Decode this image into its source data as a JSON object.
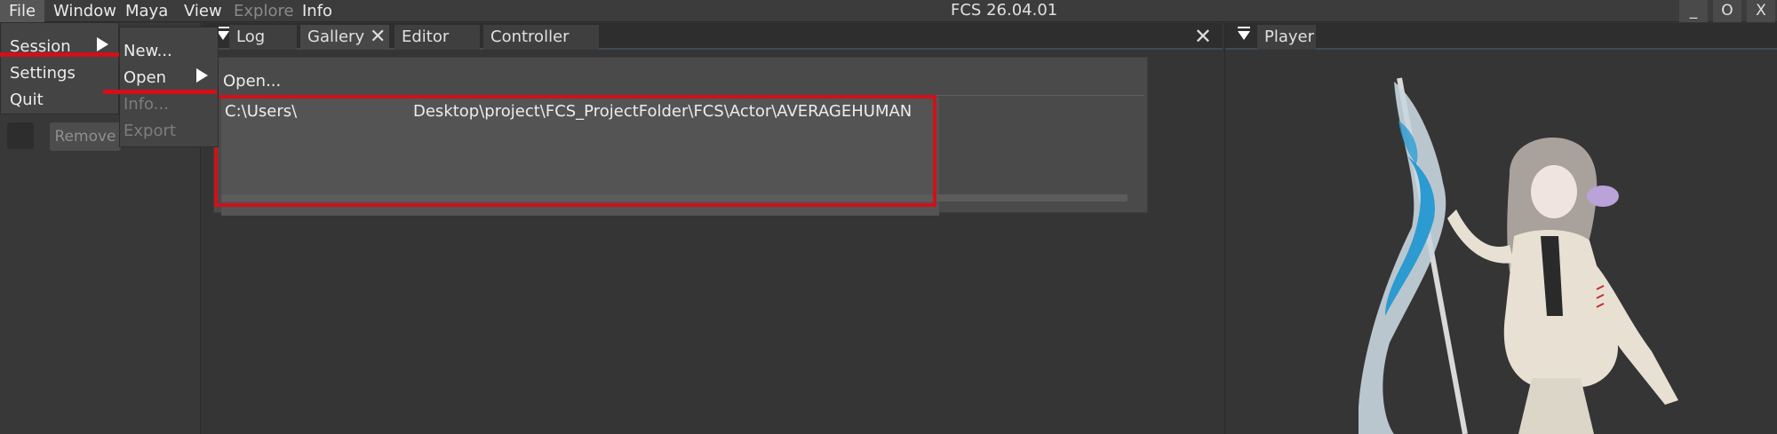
{
  "app_title": "FCS 26.04.01",
  "menubar": {
    "items": [
      "File",
      "Window",
      "Maya",
      "View",
      "Explore",
      "Info"
    ]
  },
  "window_controls": {
    "minimize": "_",
    "maximize": "O",
    "close": "X"
  },
  "file_menu": {
    "items": [
      "Session",
      "Settings",
      "Quit"
    ]
  },
  "session_menu": {
    "items": [
      "New...",
      "Open",
      "Info...",
      "Export"
    ]
  },
  "open_popup": {
    "open_label": "Open...",
    "recent_path_start": "C:\\Users\\",
    "recent_path_end": "Desktop\\project\\FCS_ProjectFolder\\FCS\\Actor\\AVERAGEHUMAN"
  },
  "left_panel": {
    "remove_label": "Remove"
  },
  "center_tabs": [
    "Log",
    "Gallery",
    "Editor",
    "Controller"
  ],
  "right_tabs": [
    "Player"
  ],
  "icons": {
    "dock_menu": "dock-menu-icon",
    "close": "close-icon",
    "submenu_arrow": "submenu-arrow-icon"
  },
  "colors": {
    "highlight_red": "#d0101a",
    "background": "#353535",
    "menu_bg": "#444444"
  }
}
